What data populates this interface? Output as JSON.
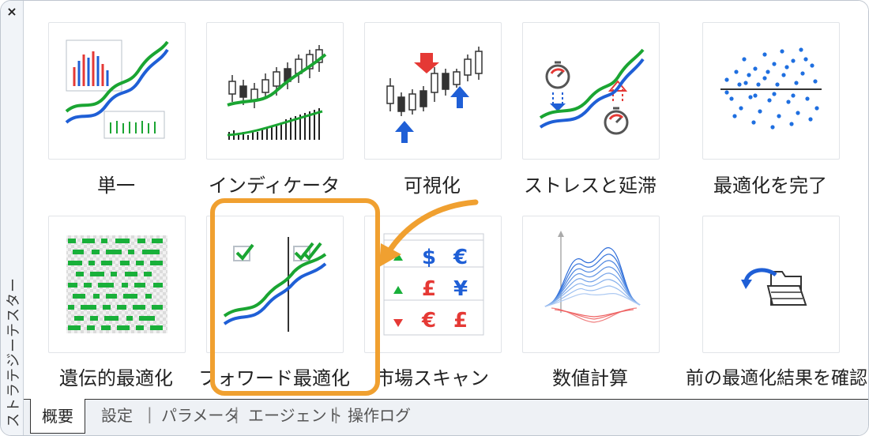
{
  "window": {
    "side_title": "ストラテジーテスター",
    "close_glyph": "×"
  },
  "tiles": [
    {
      "label": "単一"
    },
    {
      "label": "インディケータ"
    },
    {
      "label": "可視化"
    },
    {
      "label": "ストレスと延滞"
    },
    {
      "label": "最適化を完了"
    },
    {
      "label": "遺伝的最適化"
    },
    {
      "label": "フォワード最適化"
    },
    {
      "label": "市場スキャン"
    },
    {
      "label": "数値計算"
    },
    {
      "label": "前の最適化結果を確認"
    }
  ],
  "market_scan": {
    "rows": [
      {
        "arrow": "up",
        "s1": "$",
        "s2": "€"
      },
      {
        "arrow": "up",
        "s1": "£",
        "s2": "¥"
      },
      {
        "arrow": "down",
        "s1": "€",
        "s2": "£"
      }
    ]
  },
  "tabs": [
    "概要",
    "設定",
    "パラメータ",
    "エージェント",
    "操作ログ"
  ],
  "active_tab": "概要",
  "colors": {
    "accent_orange": "#f0a030",
    "line_blue": "#1f5fd6",
    "line_green": "#1aa532",
    "up_blue": "#1f5fd6",
    "down_red": "#e53935",
    "tile_border": "#e1e4e8"
  }
}
